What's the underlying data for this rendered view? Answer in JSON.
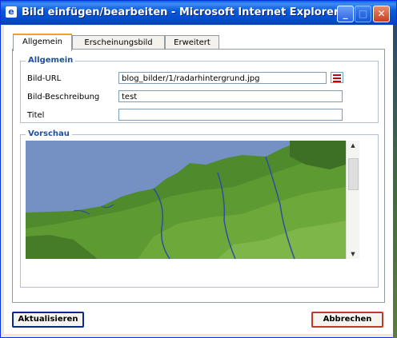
{
  "window": {
    "title": "Bild einfügen/bearbeiten - Microsoft Internet Explorer"
  },
  "tabs": [
    {
      "label": "Allgemein",
      "active": true
    },
    {
      "label": "Erscheinungsbild",
      "active": false
    },
    {
      "label": "Erweitert",
      "active": false
    }
  ],
  "general": {
    "legend": "Allgemein",
    "url_label": "Bild-URL",
    "url_value": "blog_bilder/1/radarhintergrund.jpg",
    "desc_label": "Bild-Beschreibung",
    "desc_value": "test",
    "title_label": "Titel",
    "title_value": ""
  },
  "preview": {
    "legend": "Vorschau"
  },
  "buttons": {
    "update": "Aktualisieren",
    "cancel": "Abbrechen"
  },
  "colors": {
    "titlebar": "#0a5bdb",
    "legend": "#1e4fa0",
    "accent_tab": "#f0a030"
  }
}
